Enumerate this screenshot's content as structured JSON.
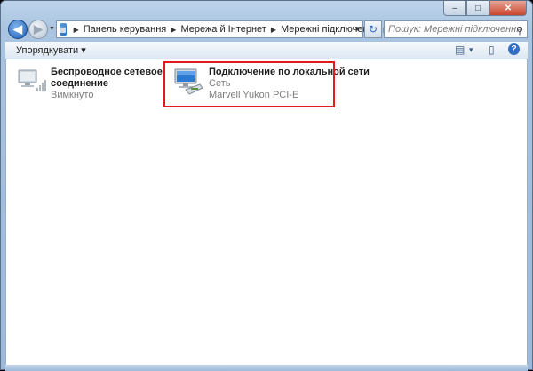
{
  "window": {
    "caption": {
      "minimize": "–",
      "maximize": "□",
      "close": "✕"
    }
  },
  "nav": {
    "back_glyph": "◀",
    "forward_glyph": "▶",
    "breadcrumbs": [
      "Панель керування",
      "Мережа й Інтернет",
      "Мережні підключення"
    ],
    "refresh_glyph": "↻",
    "search_placeholder": "Пошук: Мережні підключення",
    "search_glyph": "⚲"
  },
  "toolbar": {
    "organize_label": "Упорядкувати",
    "organize_arrow": "▾",
    "view_glyph": "▤",
    "view_arrow": "▾",
    "preview_glyph": "▯",
    "help_glyph": "?"
  },
  "connections": [
    {
      "name": "Беспроводное сетевое соединение",
      "status": "Вимкнуто",
      "device": ""
    },
    {
      "name": "Подключение по локальной сети",
      "status": "Сеть",
      "device": "Marvell Yukon PCI-E"
    }
  ],
  "colors": {
    "highlight": "#e2191e",
    "accent": "#1f5fb5"
  }
}
